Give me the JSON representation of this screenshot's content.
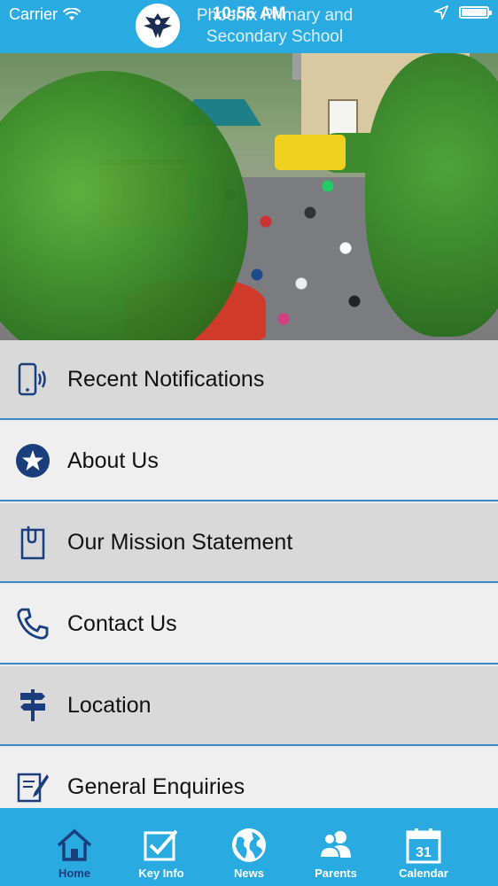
{
  "status_bar": {
    "carrier": "Carrier",
    "time": "10:56 AM",
    "battery_percent": 100
  },
  "header": {
    "title": "Phoenix Primary and Secondary School"
  },
  "hero": {
    "image_name": "school-fair-photo"
  },
  "menu": {
    "items": [
      {
        "label": "Recent Notifications",
        "icon": "phone-vibrate-icon"
      },
      {
        "label": "About Us",
        "icon": "star-circle-icon"
      },
      {
        "label": "Our Mission Statement",
        "icon": "clipboard-icon"
      },
      {
        "label": "Contact Us",
        "icon": "phone-handset-icon"
      },
      {
        "label": "Location",
        "icon": "signpost-icon"
      },
      {
        "label": "General Enquiries",
        "icon": "edit-form-icon"
      }
    ]
  },
  "tabs": [
    {
      "label": "Home",
      "icon": "home-icon",
      "active": true
    },
    {
      "label": "Key Info",
      "icon": "checkbox-icon",
      "active": false
    },
    {
      "label": "News",
      "icon": "globe-icon",
      "active": false
    },
    {
      "label": "Parents",
      "icon": "people-icon",
      "active": false
    },
    {
      "label": "Calendar",
      "icon": "calendar-icon",
      "active": false,
      "badge": "31"
    }
  ],
  "colors": {
    "header": "#29abe2",
    "accent": "#1a3d7c",
    "divider": "#3a86c6"
  }
}
